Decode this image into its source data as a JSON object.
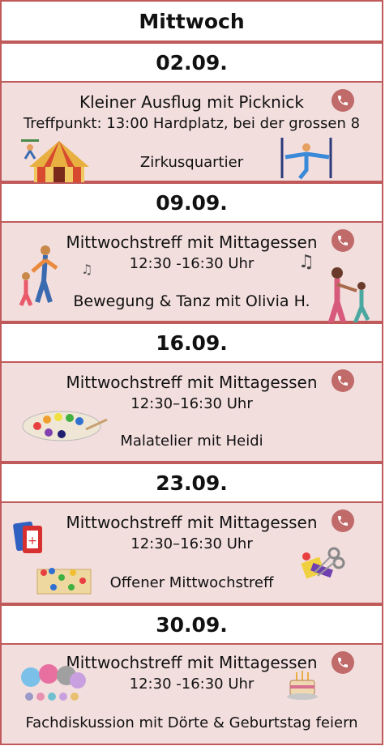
{
  "day_title": "Mittwoch",
  "days": [
    {
      "date": "02.09.",
      "title": "Kleiner Ausflug mit Picknick",
      "info": "Treffpunkt: 13:00 Hardplatz, bei der grossen 8",
      "desc": "Zirkusquartier",
      "icons": [
        "acrobat-icon",
        "circus-tent-icon",
        "aerial-acrobat-icon"
      ]
    },
    {
      "date": "09.09.",
      "title_a": "Mittwochstreff",
      "title_b": " mit ",
      "title_c": "Mittagessen",
      "time": "12:30 -16:30 Uhr",
      "desc": "Bewegung & Tanz mit Olivia H.",
      "icons": [
        "dancing-family-icon",
        "music-notes-icon",
        "dancing-pair-icon"
      ]
    },
    {
      "date": "16.09.",
      "title_a": "Mittwochstreff",
      "title_b": " mit ",
      "title_c": "Mittagessen",
      "time": "12:30–16:30 Uhr",
      "desc": "Malatelier mit Heidi",
      "icons": [
        "paint-palette-icon"
      ]
    },
    {
      "date": "23.09.",
      "title_a": "Mittwochstreff",
      "title_b": " mit ",
      "title_c": "Mittagessen",
      "time": "12:30–16:30 Uhr",
      "desc": "Offener Mittwochstreff",
      "icons": [
        "card-game-icon",
        "board-game-icon",
        "craft-supplies-icon"
      ]
    },
    {
      "date": "30.09.",
      "title_a": "Mittwochstreff",
      "title_b": " mit ",
      "title_c": "Mittagessen",
      "time": "12:30 -16:30 Uhr",
      "desc": "Fachdiskussion mit Dörte & Geburtstag feiern",
      "icons": [
        "speech-bubbles-icon",
        "birthday-cake-icon"
      ]
    }
  ],
  "colors": {
    "border": "#c05a5a",
    "card": "#f3dede",
    "phone": "#c06a6a"
  }
}
